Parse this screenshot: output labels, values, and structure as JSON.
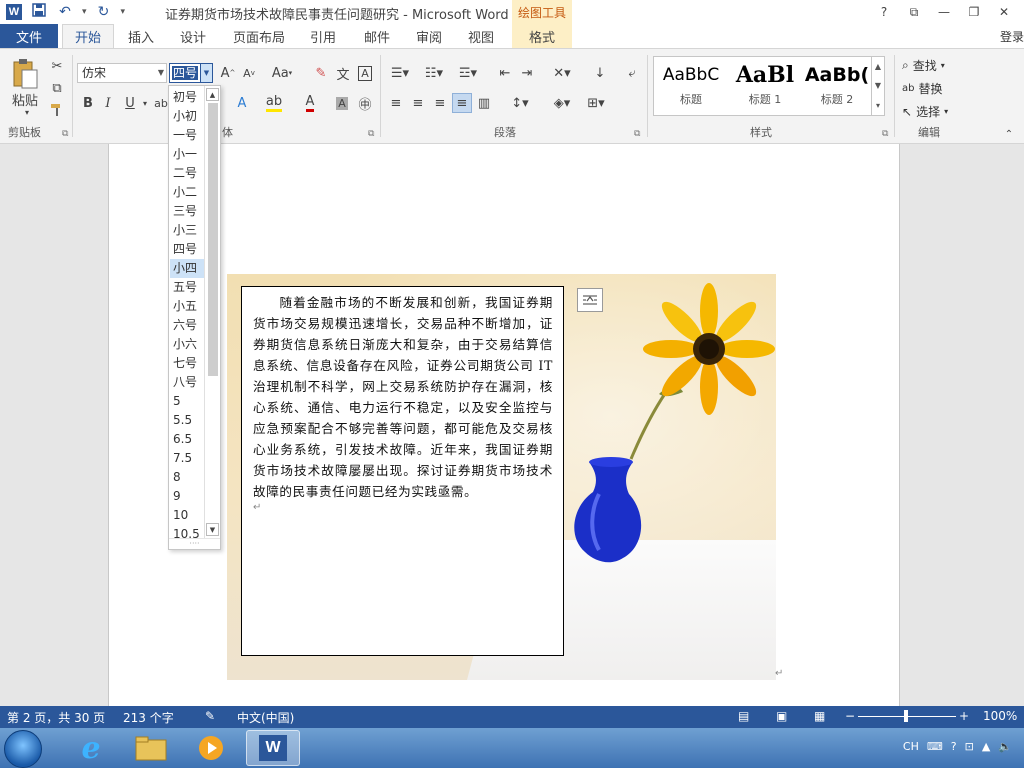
{
  "window": {
    "title": "证券期货市场技术故障民事责任问题研究 - Microsoft Word",
    "tools_tab": "绘图工具",
    "help": "?",
    "restore": "⧉",
    "minimize": "—",
    "maximize": "❐",
    "close": "✕"
  },
  "qat": {
    "logo": "W",
    "save_icon": "save-icon",
    "undo_icon": "undo-icon",
    "redo_icon": "redo-icon",
    "customize_icon": "customize-icon"
  },
  "tabs": {
    "file": "文件",
    "items": [
      "开始",
      "插入",
      "设计",
      "页面布局",
      "引用",
      "邮件",
      "审阅",
      "视图",
      "格式"
    ],
    "login": "登录"
  },
  "ribbon": {
    "clipboard": {
      "paste": "粘贴",
      "label": "剪贴板"
    },
    "font": {
      "name": "仿宋",
      "size": "四号",
      "grow": "A",
      "shrink": "A",
      "case": "Aa",
      "bold": "B",
      "italic": "I",
      "underline": "U",
      "label": "字体",
      "label_visible": "体"
    },
    "paragraph": {
      "label": "段落"
    },
    "styles": {
      "label": "样式",
      "items": [
        {
          "sample": "AaBbC",
          "name": "标题"
        },
        {
          "sample": "AaBl",
          "name": "标题 1"
        },
        {
          "sample": "AaBb(",
          "name": "标题 2"
        }
      ]
    },
    "editing": {
      "find": "查找",
      "replace": "替换",
      "select": "选择",
      "label": "编辑"
    }
  },
  "font_size_dropdown": {
    "options": [
      "初号",
      "小初",
      "一号",
      "小一",
      "二号",
      "小二",
      "三号",
      "小三",
      "四号",
      "小四",
      "五号",
      "小五",
      "六号",
      "小六",
      "七号",
      "八号",
      "5",
      "5.5",
      "6.5",
      "7.5",
      "8",
      "9",
      "10",
      "10.5"
    ],
    "highlighted": "小四"
  },
  "document": {
    "textbox_paragraph": "随着金融市场的不断发展和创新，我国证券期货市场交易规模迅速增长，交易品种不断增加，证券期货信息系统日渐庞大和复杂，由于交易结算信息系统、信息设备存在风险，证券公司期货公司 IT 治理机制不科学，网上交易系统防护存在漏洞，核心系统、通信、电力运行不稳定，以及安全监控与应急预案配合不够完善等问题，都可能危及交易核心业务系统，引发技术故障。近年来，我国证券期货市场技术故障屡屡出现。探讨证券期货市场技术故障的民事责任问题已经为实践亟需。",
    "para_mark": "↵"
  },
  "statusbar": {
    "page": "第 2 页，共 30 页",
    "words": "213 个字",
    "language": "中文(中国)",
    "zoom": "100%",
    "zoom_minus": "−",
    "zoom_plus": "+"
  },
  "taskbar": {
    "tray_lang": "CH",
    "apps": [
      "start-orb",
      "internet-explorer-icon",
      "file-explorer-icon",
      "media-player-icon",
      "word-icon"
    ]
  },
  "colors": {
    "brand": "#2b579a",
    "tools_accent": "#fdefc6",
    "dropdown_selected": "#cde2f7"
  }
}
